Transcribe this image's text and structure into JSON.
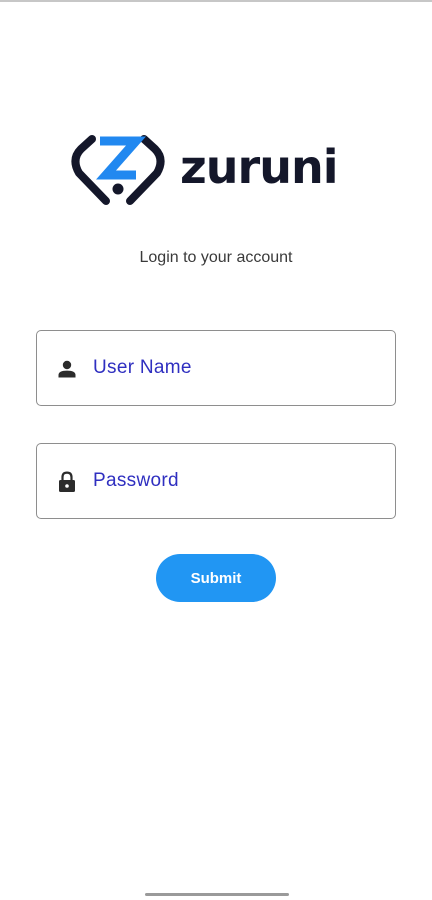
{
  "brand": {
    "name": "zuruni",
    "logo_icon": "zuruni-logo-mark",
    "colors": {
      "dark": "#14172a",
      "accent": "#2188f0"
    }
  },
  "login": {
    "subtitle": "Login to your account",
    "username": {
      "placeholder": "User Name",
      "value": "",
      "icon": "person-icon"
    },
    "password": {
      "placeholder": "Password",
      "value": "",
      "icon": "lock-icon"
    },
    "submit_label": "Submit",
    "submit_color": "#2196f3"
  }
}
